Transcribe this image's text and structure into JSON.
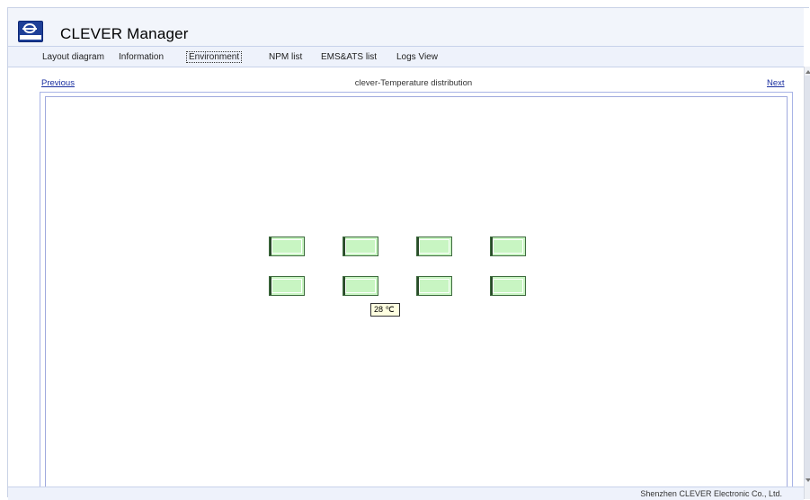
{
  "app": {
    "title": "CLEVER Manager"
  },
  "nav": {
    "items": [
      {
        "label": "Layout diagram",
        "active": false
      },
      {
        "label": "Information",
        "active": false
      },
      {
        "label": "Environment",
        "active": true
      },
      {
        "label": "NPM list",
        "active": false
      },
      {
        "label": "EMS&ATS list",
        "active": false
      },
      {
        "label": "Logs View",
        "active": false
      }
    ]
  },
  "pager": {
    "previous": "Previous",
    "title": "clever-Temperature distribution",
    "next": "Next"
  },
  "sensors": {
    "count": 8,
    "color": "#c8f5c2"
  },
  "tooltip": {
    "text": "28 ℃"
  },
  "footer": {
    "text": "Shenzhen CLEVER Electronic Co., Ltd."
  },
  "colors": {
    "accent": "#1e3f97",
    "link": "#1a2fa0",
    "sensor_fill": "#c8f5c2"
  },
  "icons": {
    "logo": "clever-logo-icon"
  }
}
